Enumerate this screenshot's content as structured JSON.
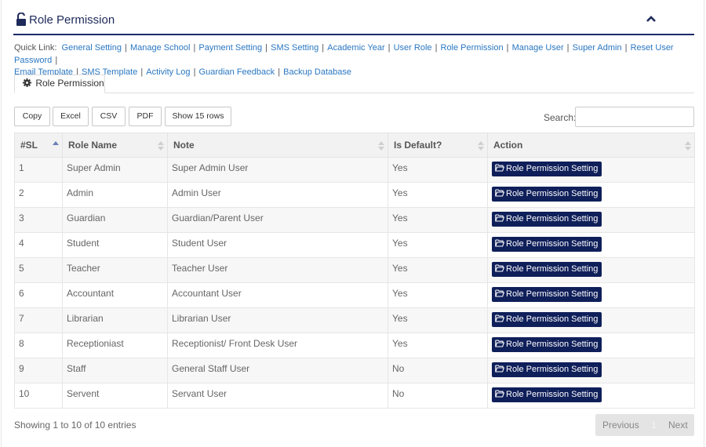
{
  "header": {
    "title": "Role Permission"
  },
  "quick_links": {
    "label": "Quick Link:",
    "items": [
      "General Setting",
      "Manage School",
      "Payment Setting",
      "SMS Setting",
      "Academic Year",
      "User Role",
      "Role Permission",
      "Manage User",
      "Super Admin",
      "Reset User Password",
      "Email Template",
      "SMS Template",
      "Activity Log",
      "Guardian Feedback",
      "Backup Database"
    ]
  },
  "tab": {
    "label": "Role Permission"
  },
  "toolbar": {
    "copy": "Copy",
    "excel": "Excel",
    "csv": "CSV",
    "pdf": "PDF",
    "show_rows": "Show 15 rows",
    "search_label": "Search:"
  },
  "table": {
    "columns": [
      "#SL",
      "Role Name",
      "Note",
      "Is Default?",
      "Action"
    ],
    "action_label": "Role Permission Setting",
    "rows": [
      [
        "1",
        "Super Admin",
        "Super Admin User",
        "Yes"
      ],
      [
        "2",
        "Admin",
        "Admin User",
        "Yes"
      ],
      [
        "3",
        "Guardian",
        "Guardian/Parent User",
        "Yes"
      ],
      [
        "4",
        "Student",
        "Student User",
        "Yes"
      ],
      [
        "5",
        "Teacher",
        "Teacher User",
        "Yes"
      ],
      [
        "6",
        "Accountant",
        "Accountant User",
        "Yes"
      ],
      [
        "7",
        "Librarian",
        "Librarian User",
        "Yes"
      ],
      [
        "8",
        "Receptioniast",
        "Receptionist/ Front Desk User",
        "Yes"
      ],
      [
        "9",
        "Staff",
        "General Staff User",
        "No"
      ],
      [
        "10",
        "Servent",
        "Servant User",
        "No"
      ]
    ]
  },
  "footer": {
    "info": "Showing 1 to 10 of 10 entries",
    "previous": "Previous",
    "page": "1",
    "next": "Next"
  },
  "colors": {
    "accent": "#0f1f5a",
    "link": "#2a77c2",
    "title_rule": "#1a2a6c"
  }
}
